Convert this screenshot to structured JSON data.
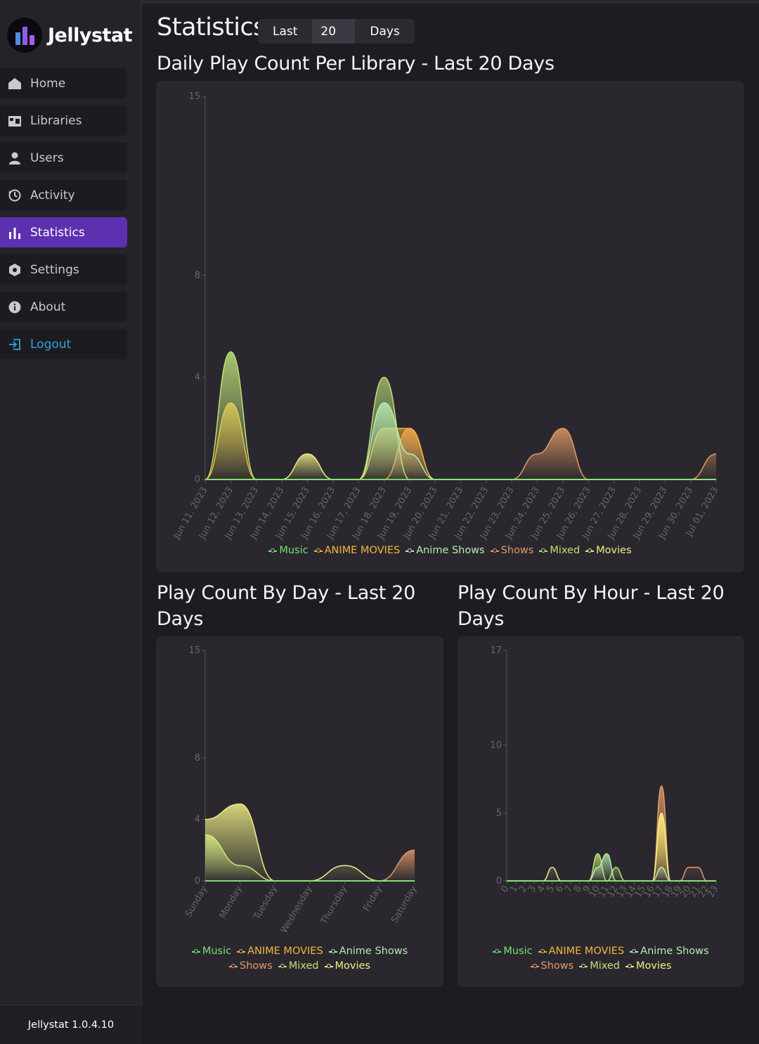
{
  "app": {
    "name": "Jellystat",
    "version": "Jellystat 1.0.4.10"
  },
  "nav": [
    {
      "label": "Home",
      "icon": "home-icon"
    },
    {
      "label": "Libraries",
      "icon": "libraries-icon"
    },
    {
      "label": "Users",
      "icon": "user-icon"
    },
    {
      "label": "Activity",
      "icon": "history-icon"
    },
    {
      "label": "Statistics",
      "icon": "bar-chart-icon",
      "active": true
    },
    {
      "label": "Settings",
      "icon": "settings-hex-icon"
    },
    {
      "label": "About",
      "icon": "info-icon"
    },
    {
      "label": "Logout",
      "icon": "logout-icon"
    }
  ],
  "header": {
    "title": "Statistics",
    "range_prefix": "Last",
    "range_value": "20",
    "range_suffix": "Days"
  },
  "sections": {
    "daily": "Daily Play Count Per Library - Last 20 Days",
    "by_day": "Play Count By Day - Last 20 Days",
    "by_hour": "Play Count By Hour - Last 20 Days"
  },
  "colors": {
    "Music": "#6fe36f",
    "ANIME MOVIES": "#f4b63d",
    "Anime Shows": "#b7ecb0",
    "Shows": "#e39a66",
    "Mixed": "#bfe07a",
    "Movies": "#f2ef86"
  },
  "legend": [
    "Music",
    "ANIME MOVIES",
    "Anime Shows",
    "Shows",
    "Mixed",
    "Movies"
  ],
  "chart_data": [
    {
      "type": "area",
      "yticks": [
        0,
        4,
        8,
        15
      ],
      "ylim": [
        0,
        15
      ],
      "categories": [
        "Jun 11, 2023",
        "Jun 12, 2023",
        "Jun 13, 2023",
        "Jun 14, 2023",
        "Jun 15, 2023",
        "Jun 16, 2023",
        "Jun 17, 2023",
        "Jun 18, 2023",
        "Jun 19, 2023",
        "Jun 20, 2023",
        "Jun 21, 2023",
        "Jun 22, 2023",
        "Jun 23, 2023",
        "Jun 24, 2023",
        "Jun 25, 2023",
        "Jun 26, 2023",
        "Jun 27, 2023",
        "Jun 28, 2023",
        "Jun 29, 2023",
        "Jun 30, 2023",
        "Jul 01, 2023"
      ],
      "series": [
        {
          "name": "Music",
          "values": [
            0,
            0,
            0,
            0,
            0,
            0,
            0,
            0,
            0,
            0,
            0,
            0,
            0,
            0,
            0,
            0,
            0,
            0,
            0,
            0,
            0
          ]
        },
        {
          "name": "ANIME MOVIES",
          "values": [
            0,
            3,
            0,
            0,
            0,
            0,
            0,
            2,
            2,
            0,
            0,
            0,
            0,
            0,
            0,
            0,
            0,
            0,
            0,
            0,
            0
          ]
        },
        {
          "name": "Anime Shows",
          "values": [
            0,
            0,
            0,
            0,
            0,
            0,
            0,
            3,
            1,
            0,
            0,
            0,
            0,
            0,
            0,
            0,
            0,
            0,
            0,
            0,
            0
          ]
        },
        {
          "name": "Shows",
          "values": [
            0,
            0,
            0,
            0,
            0,
            0,
            0,
            0,
            2,
            0,
            0,
            0,
            0,
            1,
            2,
            0,
            0,
            0,
            0,
            0,
            1
          ]
        },
        {
          "name": "Mixed",
          "values": [
            0,
            5,
            0,
            0,
            0,
            0,
            0,
            4,
            0,
            0,
            0,
            0,
            0,
            0,
            0,
            0,
            0,
            0,
            0,
            0,
            0
          ]
        },
        {
          "name": "Movies",
          "values": [
            0,
            0,
            0,
            0,
            1,
            0,
            0,
            0,
            0,
            0,
            0,
            0,
            0,
            0,
            0,
            0,
            0,
            0,
            0,
            0,
            0
          ]
        }
      ]
    },
    {
      "type": "area",
      "yticks": [
        0,
        4,
        8,
        15
      ],
      "ylim": [
        0,
        15
      ],
      "categories": [
        "Sunday",
        "Monday",
        "Tuesday",
        "Wednesday",
        "Thursday",
        "Friday",
        "Saturday"
      ],
      "series": [
        {
          "name": "Music",
          "values": [
            0,
            0,
            0,
            0,
            0,
            0,
            0
          ]
        },
        {
          "name": "ANIME MOVIES",
          "values": [
            0,
            0,
            0,
            0,
            0,
            0,
            0
          ]
        },
        {
          "name": "Anime Shows",
          "values": [
            0,
            0,
            0,
            0,
            0,
            0,
            0
          ]
        },
        {
          "name": "Shows",
          "values": [
            0,
            0,
            0,
            0,
            0,
            0,
            2
          ]
        },
        {
          "name": "Mixed",
          "values": [
            3,
            1,
            0,
            0,
            0,
            0,
            0
          ]
        },
        {
          "name": "Movies",
          "values": [
            4,
            5,
            0,
            0,
            1,
            0,
            0
          ]
        }
      ]
    },
    {
      "type": "area",
      "yticks": [
        0,
        5,
        10,
        17
      ],
      "ylim": [
        0,
        17
      ],
      "categories": [
        "0",
        "1",
        "2",
        "3",
        "4",
        "5",
        "6",
        "7",
        "8",
        "9",
        "10",
        "11",
        "12",
        "13",
        "14",
        "15",
        "16",
        "17",
        "18",
        "19",
        "20",
        "21",
        "22",
        "23"
      ],
      "series": [
        {
          "name": "Music",
          "values": [
            0,
            0,
            0,
            0,
            0,
            0,
            0,
            0,
            0,
            0,
            0,
            0,
            0,
            0,
            0,
            0,
            0,
            0,
            0,
            0,
            0,
            0,
            0,
            0
          ]
        },
        {
          "name": "ANIME MOVIES",
          "values": [
            0,
            0,
            0,
            0,
            0,
            0,
            0,
            0,
            0,
            0,
            0,
            0,
            0,
            0,
            0,
            0,
            0,
            5,
            0,
            0,
            0,
            0,
            0,
            0
          ]
        },
        {
          "name": "Anime Shows",
          "values": [
            0,
            0,
            0,
            0,
            0,
            0,
            0,
            0,
            0,
            0,
            1,
            2,
            0,
            0,
            0,
            0,
            0,
            1,
            0,
            0,
            0,
            0,
            0,
            0
          ]
        },
        {
          "name": "Shows",
          "values": [
            0,
            0,
            0,
            0,
            0,
            0,
            0,
            0,
            0,
            0,
            0,
            0,
            0,
            0,
            0,
            0,
            0,
            7,
            0,
            0,
            1,
            1,
            0,
            0
          ]
        },
        {
          "name": "Mixed",
          "values": [
            0,
            0,
            0,
            0,
            0,
            0,
            0,
            0,
            0,
            0,
            2,
            0,
            1,
            0,
            0,
            0,
            0,
            0,
            0,
            0,
            0,
            0,
            0,
            0
          ]
        },
        {
          "name": "Movies",
          "values": [
            0,
            0,
            0,
            0,
            0,
            1,
            0,
            0,
            0,
            0,
            0,
            0,
            0,
            0,
            0,
            0,
            0,
            5,
            0,
            0,
            0,
            0,
            0,
            0
          ]
        }
      ]
    }
  ]
}
